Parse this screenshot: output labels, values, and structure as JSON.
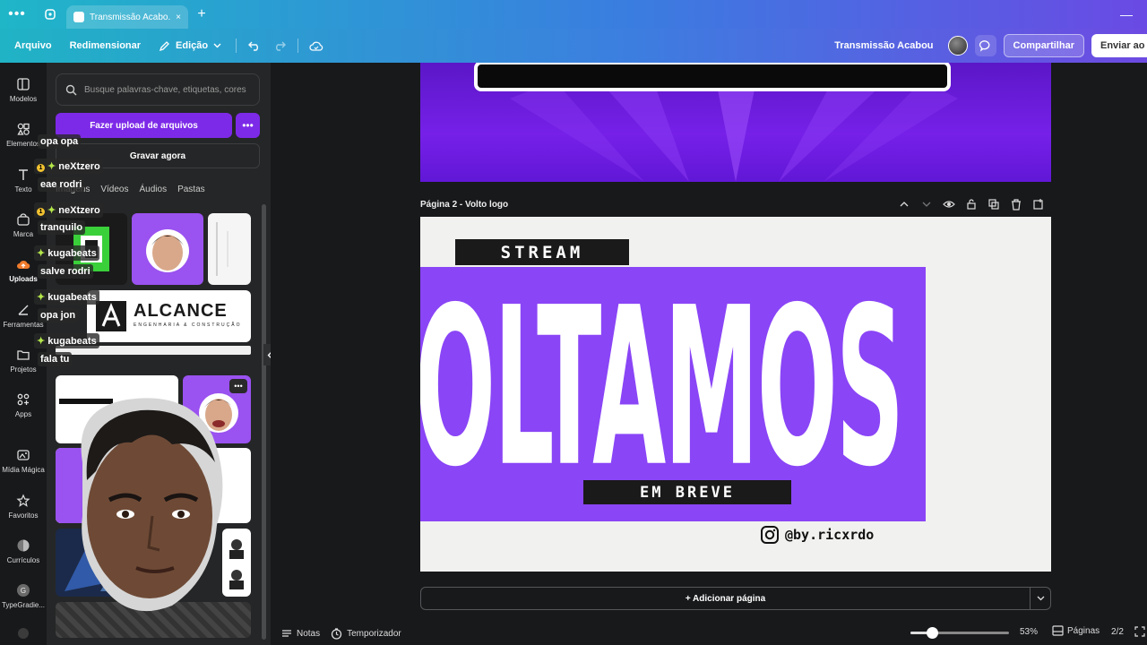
{
  "browser": {
    "menu_dots": "•••",
    "tab_title": "Transmissão Acabo...",
    "tab_close": "×",
    "new_tab": "+",
    "minimize": "—"
  },
  "toolbar": {
    "file": "Arquivo",
    "resize": "Redimensionar",
    "edit": "Edição",
    "doc_title": "Transmissão Acabou",
    "share": "Compartilhar",
    "send": "Enviar ao p"
  },
  "rail": {
    "items": [
      {
        "label": "Modelos",
        "icon": "templates-icon"
      },
      {
        "label": "Elementos",
        "icon": "elements-icon"
      },
      {
        "label": "Texto",
        "icon": "text-icon"
      },
      {
        "label": "Marca",
        "icon": "brand-icon"
      },
      {
        "label": "Uploads",
        "icon": "uploads-icon"
      },
      {
        "label": "Ferramentas",
        "icon": "tools-icon"
      },
      {
        "label": "Projetos",
        "icon": "folder-icon"
      },
      {
        "label": "Apps",
        "icon": "apps-icon"
      },
      {
        "label": "Mídia Mágica",
        "icon": "magic-media-icon"
      },
      {
        "label": "Favoritos",
        "icon": "star-icon"
      },
      {
        "label": "Currículos",
        "icon": "resume-icon"
      },
      {
        "label": "TypeGradie...",
        "icon": "typegradient-icon"
      }
    ]
  },
  "panel": {
    "search_placeholder": "Busque palavras-chave, etiquetas, cores",
    "upload_label": "Fazer upload de arquivos",
    "more": "•••",
    "record_label": "Gravar agora",
    "media_tabs": [
      "Imagens",
      "Vídeos",
      "Áudios",
      "Pastas"
    ],
    "alcance_text": "ALCANCE",
    "alcance_sub": "ENGENHARIA & CONSTRUÇÃO"
  },
  "chat": {
    "messages": [
      {
        "text": "opa opa"
      },
      {
        "text": "neXtzero"
      },
      {
        "text": "eae rodri"
      },
      {
        "text": "neXtzero"
      },
      {
        "text": "tranquilo"
      },
      {
        "text": "kugabeats"
      },
      {
        "text": "salve rodri"
      },
      {
        "text": "kugabeats"
      },
      {
        "text": "opa jon"
      },
      {
        "text": "kugabeats"
      },
      {
        "text": "fala tu"
      }
    ],
    "badge": "1",
    "star": "✦"
  },
  "canvas": {
    "page2_label": "Página 2 - Volto logo",
    "stream_text": "STREAM",
    "main_text": "VOLTAMOS",
    "breve_text": "EM BREVE",
    "handle": "@by.ricxrdo",
    "add_page": "+ Adicionar página"
  },
  "bottom": {
    "notes": "Notas",
    "timer": "Temporizador",
    "zoom_percent": 53,
    "zoom_label": "53%",
    "pages_label": "Páginas",
    "page_count": "2/2"
  },
  "colors": {
    "accent": "#7d2ae8",
    "banner_purple": "#8a45f6"
  }
}
